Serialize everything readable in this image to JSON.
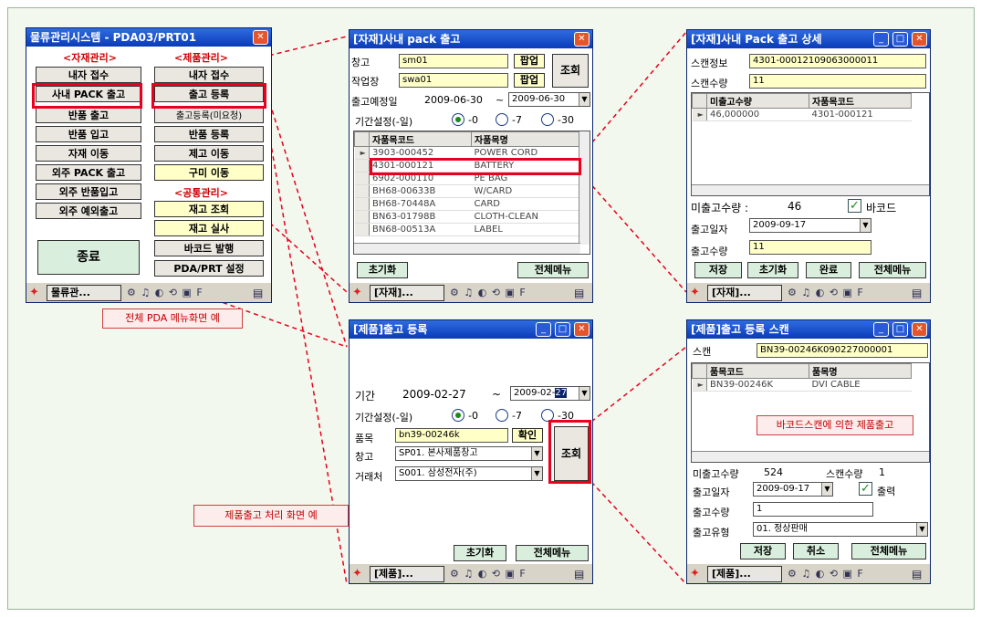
{
  "colors": {
    "accent_red": "#e8001c",
    "title_blue": "#0a3bb8",
    "note_bg": "#fdecec",
    "input_yellow": "#ffffc8"
  },
  "taskbar": {
    "icons": "⚙ ♫ ◐ ⟲ ▣ F"
  },
  "menu_win": {
    "title": "물류관리시스템 - PDA03/PRT01",
    "sec_material": "<자재관리>",
    "sec_product": "<제품관리>",
    "sec_common": "<공통관리>",
    "left_buttons": [
      "내자 접수",
      "사내 PACK 출고",
      "반품 출고",
      "반품 입고",
      "자재 이동",
      "외주 PACK 출고",
      "외주 반품입고",
      "외주 예외출고"
    ],
    "right_buttons_a": [
      "내자 접수",
      "출고 등록",
      "출고등록(미요청)",
      "반품 등록",
      "제고 이동",
      "구미 이동"
    ],
    "right_buttons_b": [
      "재고 조회",
      "재고 실사",
      "바코드 발행",
      "PDA/PRT 설정"
    ],
    "exit_button": "종료",
    "taskbar_label": "물류관..."
  },
  "note_menu": "전체 PDA 메뉴화면 예",
  "note_product": "제품출고 처리 화면 예",
  "pack_win": {
    "title": "[자재]사내 pack 출고",
    "warehouse_label": "창고",
    "warehouse_value": "sm01",
    "workplace_label": "작업장",
    "workplace_value": "swa01",
    "popup_button": "팝업",
    "query_button": "조회",
    "date_label": "출고예정일",
    "date_from": "2009-06-30",
    "tilde": "~",
    "date_to": "2009-06-30",
    "period_label": "기간설정(-일)",
    "radio_opts": [
      "-0",
      "-7",
      "-30"
    ],
    "columns": [
      "자품목코드",
      "자품목명"
    ],
    "rows": [
      [
        "3903-000452",
        "POWER CORD"
      ],
      [
        "4301-000121",
        "BATTERY"
      ],
      [
        "6902-000110",
        "PE BAG"
      ],
      [
        "BH68-00633B",
        "W/CARD"
      ],
      [
        "BH68-70448A",
        "CARD"
      ],
      [
        "BN63-01798B",
        "CLOTH-CLEAN"
      ],
      [
        "BN68-00513A",
        "LABEL"
      ]
    ],
    "reset_button": "초기화",
    "menu_button": "전체메뉴",
    "taskbar_label": "[자재]..."
  },
  "detail_win": {
    "title": "[자재]사내 Pack 출고 상세",
    "scan_label": "스캔정보",
    "scan_value": "4301-00012109063000011",
    "scan_qty_label": "스캔수량",
    "scan_qty_value": "11",
    "columns": [
      "미출고수량",
      "자품목코드"
    ],
    "row": [
      "46,000000",
      "4301-000121"
    ],
    "remain_label": "미출고수량 :",
    "remain_value": "46",
    "barcode_label": "바코드",
    "date_label": "출고일자",
    "date_value": "2009-09-17",
    "qty_label": "출고수량",
    "qty_value": "11",
    "buttons": [
      "저장",
      "초기화",
      "완료",
      "전체메뉴"
    ],
    "taskbar_label": "[자재]..."
  },
  "prod_win": {
    "title": "[제품]출고 등록",
    "period_label": "기간",
    "date_from": "2009-02-27",
    "tilde": "~",
    "date_to_main": "2009-02-",
    "date_to_sel": "27",
    "period_set_label": "기간설정(-일)",
    "radio_opts": [
      "-0",
      "-7",
      "-30"
    ],
    "item_label": "품목",
    "item_value": "bn39-00246k",
    "confirm_button": "확인",
    "warehouse_label": "창고",
    "warehouse_value": "SP01. 본사제품창고",
    "client_label": "거래처",
    "client_value": "S001. 삼성전자(주)",
    "query_button": "조회",
    "reset_button": "초기화",
    "menu_button": "전체메뉴",
    "taskbar_label": "[제품]..."
  },
  "scan_win": {
    "title": "[제품]출고 등록 스캔",
    "scan_label": "스캔",
    "scan_value": "BN39-00246K090227000001",
    "columns": [
      "품목코드",
      "품목명"
    ],
    "row": [
      "BN39-00246K",
      "DVI CABLE"
    ],
    "note": "바코드스캔에 의한 제품출고",
    "remain_label": "미출고수량",
    "remain_value": "524",
    "scan_qty_label": "스캔수량",
    "scan_qty_value": "1",
    "date_label": "출고일자",
    "date_value": "2009-09-17",
    "print_label": "출력",
    "qty_label": "출고수량",
    "qty_value": "1",
    "type_label": "출고유형",
    "type_value": "01. 정상판매",
    "buttons": [
      "저장",
      "취소",
      "전체메뉴"
    ],
    "taskbar_label": "[제품]..."
  }
}
